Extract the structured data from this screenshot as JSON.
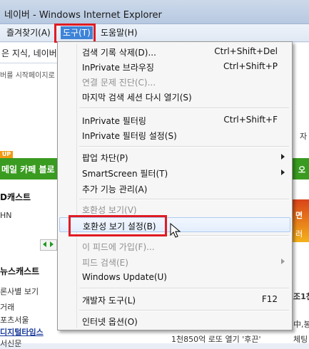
{
  "window": {
    "title": "네이버 - Windows Internet Explorer"
  },
  "menubar": {
    "items": [
      {
        "label": "즐겨찾기(A)"
      },
      {
        "label": "도구(T)"
      },
      {
        "label": "도움말(H)"
      }
    ],
    "active_item": "도구(T)"
  },
  "background_page": {
    "search_text": "은 지식, 네이버",
    "start_page_text": "버를 시작페이지로",
    "green_bar_text": "메일 카페 블로",
    "up_badge": "UP",
    "section1": "D캐스트",
    "section1_sub": "HN",
    "section2": "뉴스캐스트",
    "section2_sub": "론사별 보기",
    "news_items": [
      "거래",
      "포츠서울",
      "디지털타임스",
      "서신문"
    ],
    "right_snippets": [
      "자",
      "오",
      "면",
      "러",
      "조1천",
      "中,봉",
      "체팅"
    ],
    "bottom_news": "1천850억 로또 열기 '후끈'"
  },
  "tools_menu": {
    "items": [
      {
        "label": "검색 기록 삭제(D)...",
        "shortcut": "Ctrl+Shift+Del",
        "enabled": true,
        "submenu": false
      },
      {
        "label": "InPrivate 브라우징",
        "shortcut": "Ctrl+Shift+P",
        "enabled": true,
        "submenu": false
      },
      {
        "label": "연결 문제 진단(C)...",
        "shortcut": "",
        "enabled": false,
        "submenu": false
      },
      {
        "label": "마지막 검색 세션 다시 열기(S)",
        "shortcut": "",
        "enabled": true,
        "submenu": false
      },
      {
        "label": "InPrivate 필터링",
        "shortcut": "Ctrl+Shift+F",
        "enabled": true,
        "submenu": false
      },
      {
        "label": "InPrivate 필터링 설정(S)",
        "shortcut": "",
        "enabled": true,
        "submenu": false
      },
      {
        "label": "팝업 차단(P)",
        "shortcut": "",
        "enabled": true,
        "submenu": true
      },
      {
        "label": "SmartScreen 필터(T)",
        "shortcut": "",
        "enabled": true,
        "submenu": true
      },
      {
        "label": "추가 기능 관리(A)",
        "shortcut": "",
        "enabled": true,
        "submenu": false
      },
      {
        "label": "호환성 보기(V)",
        "shortcut": "",
        "enabled": false,
        "submenu": false
      },
      {
        "label": "호환성 보기 설정(B)",
        "shortcut": "",
        "enabled": true,
        "submenu": false,
        "hovered": true
      },
      {
        "label": "이 피드에 가입(F)...",
        "shortcut": "",
        "enabled": false,
        "submenu": false
      },
      {
        "label": "피드 검색(E)",
        "shortcut": "",
        "enabled": false,
        "submenu": true
      },
      {
        "label": "Windows Update(U)",
        "shortcut": "",
        "enabled": true,
        "submenu": false
      },
      {
        "label": "개발자 도구(L)",
        "shortcut": "F12",
        "enabled": true,
        "submenu": false
      },
      {
        "label": "인터넷 옵션(O)",
        "shortcut": "",
        "enabled": true,
        "submenu": false
      }
    ]
  },
  "colors": {
    "highlight_box": "#e01b23",
    "menu_active": "#3e83d8",
    "green_bar": "#3a9b21"
  }
}
